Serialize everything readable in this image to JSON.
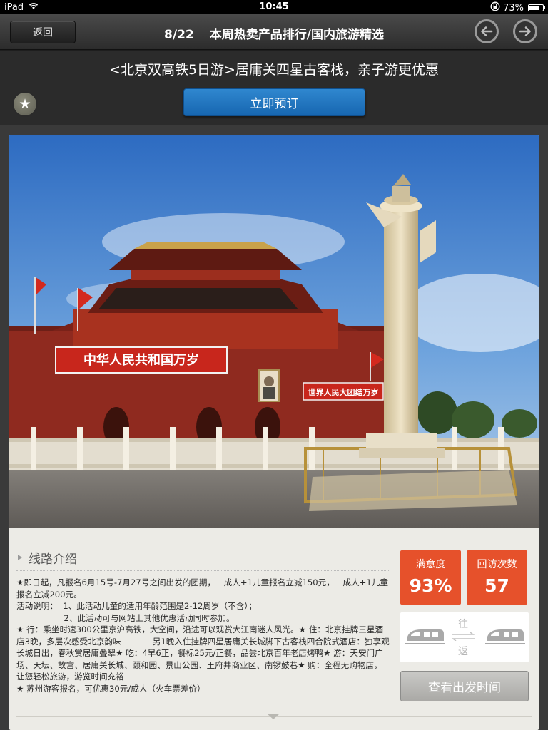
{
  "status_bar": {
    "device": "iPad",
    "time": "10:45",
    "battery": "73%",
    "battery_level": 0.73,
    "icons": [
      "wifi-icon",
      "orientation-lock-icon",
      "battery-icon"
    ]
  },
  "nav": {
    "back_label": "返回",
    "counter": "8/22",
    "title": "本周热卖产品排行/国内旅游精选",
    "prev_icon": "arrow-left-icon",
    "next_icon": "arrow-right-icon"
  },
  "promo": {
    "title": "<北京双高铁5日游>居庸关四星古客栈，亲子游更优惠",
    "favorite_icon": "star-icon",
    "book_label": "立即预订"
  },
  "photo": {
    "description_icon": "tiananmen-photo",
    "banner_left": "中华人民共和国万岁",
    "banner_right": "世界人民大团结万岁"
  },
  "intro": {
    "label": "线路介绍",
    "paragraphs": [
      "★即日起，凡报名6月15号-7月27号之间出发的团期，一成人+1儿童报名立减150元，二成人+1儿童报名立减200元。",
      "活动说明：  1、此活动儿童的适用年龄范围是2-12周岁（不含）；",
      "                  2、此活动可与网站上其他优惠活动同时参加。",
      "",
      "★ 行：乘坐时速300公里京沪高铁，大空间，沿途可以观赏大江南迷人风光。★ 住：北京挂牌三星酒店3晚，多层次感受北京韵味            另1晚入住挂牌四星居庸关长城脚下古客栈四合院式酒店：独享观长城日出，春秋赏居庸叠翠★ 吃：4早6正，餐标25元/正餐，品尝北京百年老店烤鸭★ 游：天安门广场、天坛、故宫、居庸关长城、颐和园、景山公园、王府井商业区、南锣鼓巷★ 购：全程无购物店，让您轻松旅游，游览时间充裕",
      "★ 苏州游客报名，可优惠30元/成人（火车票差价）"
    ]
  },
  "stats": [
    {
      "label": "满意度",
      "value": "93%"
    },
    {
      "label": "回访次数",
      "value": "57"
    }
  ],
  "transport": {
    "go_label": "往",
    "return_label": "返",
    "icon": "train-icon",
    "swap_icon": "swap-arrows-icon"
  },
  "depart_button_label": "查看出发时间",
  "more_icon": "chevron-down-icon",
  "colors": {
    "accent_blue": "#1f74c0",
    "stat_orange": "#e6512b",
    "card_bg": "#ecebe6"
  }
}
